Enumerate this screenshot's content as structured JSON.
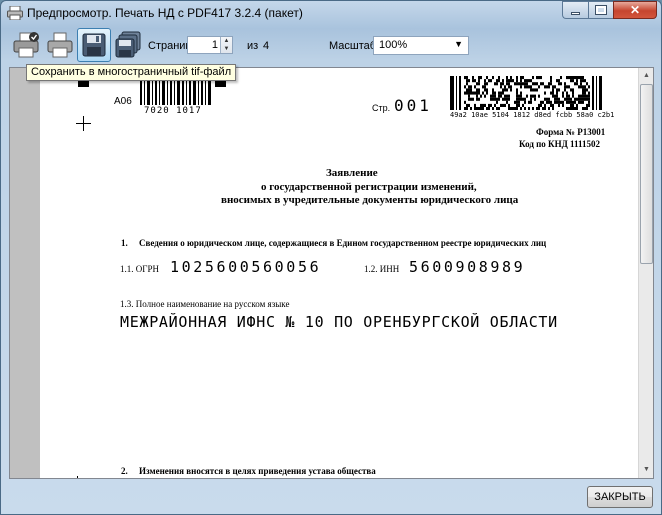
{
  "window": {
    "title": "Предпросмотр. Печать НД с PDF417 3.2.4 (пакет)",
    "close_glyph": "✕"
  },
  "toolbar": {
    "buttons": [
      {
        "name": "print-settings-icon"
      },
      {
        "name": "print-icon"
      },
      {
        "name": "save-icon"
      },
      {
        "name": "save-multipage-icon"
      }
    ],
    "page_label": "Страница",
    "page_value": "1",
    "of_label": "из",
    "page_total": "4",
    "zoom_label": "Масштаб",
    "zoom_value": "100%"
  },
  "tooltip": "Сохранить в многостраничный tif-файл",
  "document": {
    "code_a": "А06",
    "barcode_number": "7020 1017",
    "page_prefix": "Стр.",
    "page_number": "001",
    "pdf417_caption": "49a2 10ae 5104 1812 d8ed fcbb 58a0 c2b1",
    "form_line": "Форма № Р13001",
    "knd_line": "Код по КНД 1111502",
    "heading_1": "Заявление",
    "heading_2": "о государственной регистрации изменений,",
    "heading_3": "вносимых в учредительные документы юридического лица",
    "section_1_num": "1.",
    "section_1_text": "Сведения о юридическом лице, содержащиеся в Едином государственном реестре юридических лиц",
    "ogrn_label": "1.1. ОГРН",
    "ogrn_value": "1025600560056",
    "inn_label": "1.2. ИНН",
    "inn_value": "5600908989",
    "name_label": "1.3. Полное наименование на русском языке",
    "name_value": "МЕЖРАЙОННАЯ ИФНС № 10 ПО ОРЕНБУРГСКОЙ ОБЛАСТИ",
    "section_2_num": "2.",
    "section_2_text": "Изменения вносятся в целях приведения устава общества"
  },
  "footer": {
    "close_label": "ЗАКРЫТЬ"
  }
}
